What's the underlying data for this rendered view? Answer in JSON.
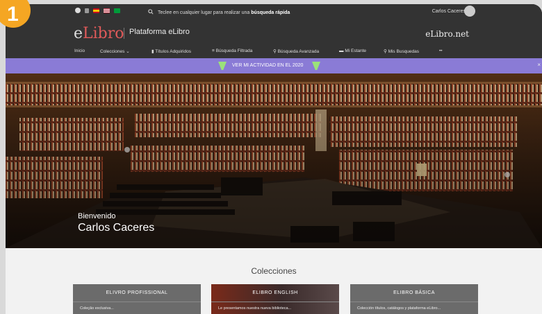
{
  "step": "1",
  "topbar": {
    "search_prefix": "Teclee en cualquier lugar para realizar una",
    "search_bold": "búsqueda rápida",
    "username": "Carlos Caceres"
  },
  "brand": {
    "logo_e": "e",
    "logo_rest": "Libro",
    "platform": "Plataforma eLibro",
    "right": "eLibro.net"
  },
  "nav": {
    "items": [
      "Inicio",
      "Colecciones",
      "Títulos Adquiridos",
      "Búsqueda Filtrada",
      "Búsqueda Avanzada",
      "Mi Estante",
      "Mis Busquedas",
      "••"
    ]
  },
  "activity": {
    "label": "VER MI ACTIVIDAD EN EL 2020",
    "close": "×"
  },
  "hero": {
    "greeting": "Bienvenido",
    "name": "Carlos Caceres"
  },
  "collections": {
    "title": "Colecciones",
    "cards": [
      {
        "title": "ELIVRO PROFISSIONAL",
        "desc": "Coleção exclusiva..."
      },
      {
        "title": "ELIBRO ENGLISH",
        "desc": "Le presentamos nuestra nueva biblioteca..."
      },
      {
        "title": "ELIBRO BÁSICA",
        "desc": "Colección títulos, catálogos y plataforma eLibro..."
      }
    ]
  },
  "colors": {
    "accent_bar": "#8a7bd6",
    "dark": "#333333",
    "logo_red": "#e05a5a"
  }
}
